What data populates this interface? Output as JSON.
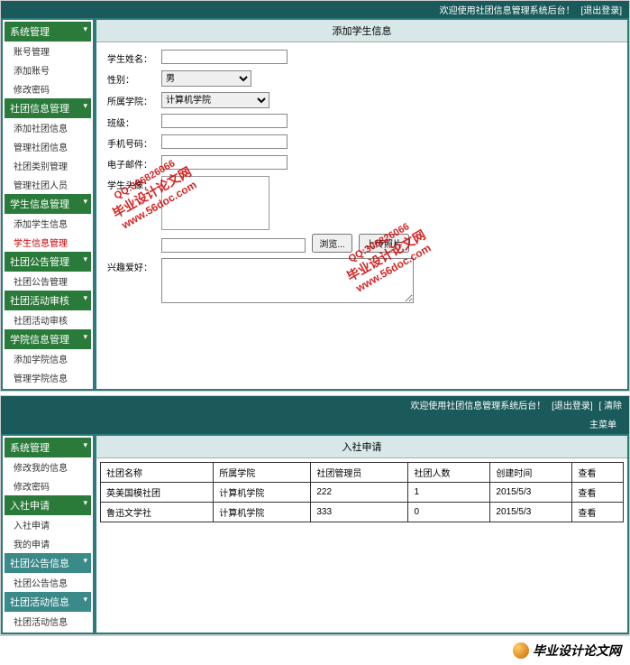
{
  "topbar1": {
    "welcome": "欢迎使用社团信息管理系统后台！",
    "logout": "[退出登录]"
  },
  "topbar2": {
    "welcome": "欢迎使用社团信息管理系统后台！",
    "logout": "[退出登录]",
    "clear": "[ 清除"
  },
  "sidebar1": {
    "g1": {
      "hdr": "系统管理",
      "items": [
        "账号管理",
        "添加账号",
        "修改密码"
      ]
    },
    "g2": {
      "hdr": "社团信息管理",
      "items": [
        "添加社团信息",
        "管理社团信息",
        "社团类别管理",
        "管理社团人员"
      ]
    },
    "g3": {
      "hdr": "学生信息管理",
      "items": [
        "添加学生信息",
        "学生信息管理"
      ]
    },
    "g4": {
      "hdr": "社团公告管理",
      "items": [
        "社团公告管理"
      ]
    },
    "g5": {
      "hdr": "社团活动审核",
      "items": [
        "社团活动审核"
      ]
    },
    "g6": {
      "hdr": "学院信息管理",
      "items": [
        "添加学院信息",
        "管理学院信息"
      ]
    }
  },
  "sidebar2": {
    "g1": {
      "hdr": "系统管理",
      "items": [
        "修改我的信息",
        "修改密码"
      ]
    },
    "g2": {
      "hdr": "入社申请",
      "items": [
        "入社申请",
        "我的申请"
      ]
    },
    "g3": {
      "hdr": "社团公告信息",
      "items": [
        "社团公告信息"
      ]
    },
    "g4": {
      "hdr": "社团活动信息",
      "items": [
        "社团活动信息"
      ]
    }
  },
  "form": {
    "title": "添加学生信息",
    "lbl_name": "学生姓名：",
    "lbl_gender": "性别：",
    "lbl_college": "所属学院：",
    "lbl_class": "班级：",
    "lbl_phone": "手机号码：",
    "lbl_email": "电子邮件：",
    "lbl_avatar": "学生头像：",
    "lbl_hobby": "兴趣爱好：",
    "opt_gender": "男",
    "opt_college": "计算机学院",
    "btn_browse": "浏览...",
    "btn_upload": "上传照片"
  },
  "table": {
    "title": "入社申请",
    "lottery": "主菜单",
    "cols": [
      "社团名称",
      "所属学院",
      "社团管理员",
      "社团人数",
      "创建时间",
      "查看"
    ],
    "rows": [
      {
        "name": "英美国模社团",
        "college": "计算机学院",
        "admin": "222",
        "count": "1",
        "time": "2015/5/3",
        "view": "查看"
      },
      {
        "name": "鲁迅文学社",
        "college": "计算机学院",
        "admin": "333",
        "count": "0",
        "time": "2015/5/3",
        "view": "查看"
      }
    ]
  },
  "footer": "毕业设计论文网",
  "watermark": {
    "txt": "毕业设计论文网",
    "url": "www.56doc.com",
    "qq": "QQ:306826066"
  },
  "chev": "▾"
}
